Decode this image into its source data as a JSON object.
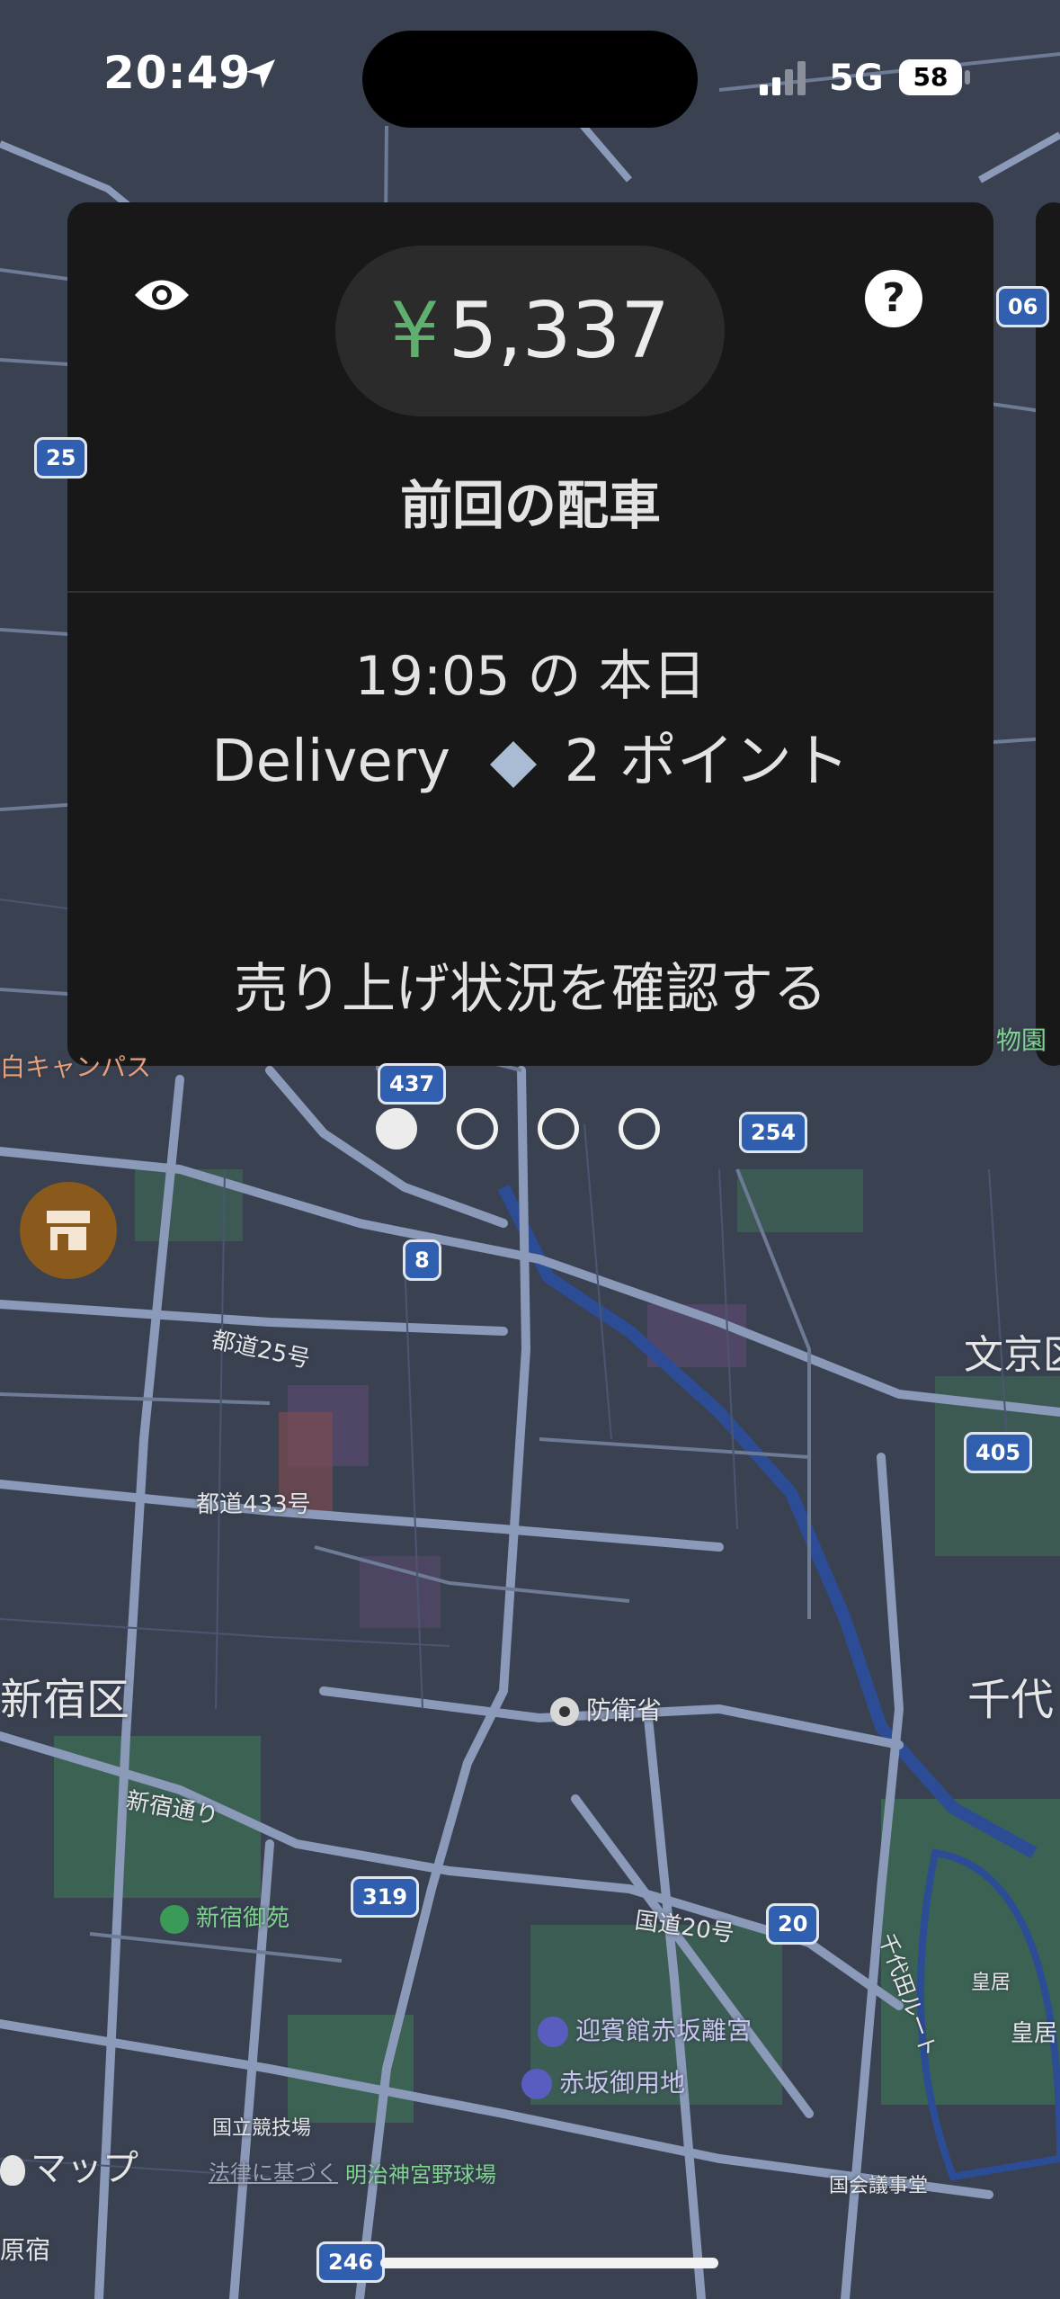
{
  "status_bar": {
    "time": "20:49",
    "network": "5G",
    "battery": "58"
  },
  "earnings_card": {
    "currency": "¥",
    "amount": "5,337",
    "title": "前回の配車",
    "trip_time": "19:05 の 本日",
    "trip_type": "Delivery",
    "points": "2 ポイント",
    "link_label": "売り上げ状況を確認する"
  },
  "pager": {
    "count": 4,
    "active_index": 0
  },
  "map": {
    "labels": {
      "bunkyo": "文京区",
      "shinjuku_ku": "新宿区",
      "chiyoda": "千代",
      "road_25": "都道25号",
      "road_433": "都道433号",
      "shinjuku_dori": "新宿通り",
      "kokudo_20": "国道20号",
      "boeisho": "防衛省",
      "shinjuku_gyoen": "新宿御苑",
      "geihinkan": "迎賓館赤坂離宮",
      "akasaka_goyochi": "赤坂御用地",
      "kokuritsu": "国立競技場",
      "jingu": "明治神宮野球場",
      "kokkai": "国会議事堂",
      "kokyo": "皇居",
      "kokyo2": "皇居",
      "harajuku": "原宿",
      "campus": "白キャンパス",
      "museum": "物園",
      "legal": "法律に基づく",
      "brand": "マップ",
      "chiyoda_route": "千代田ルート"
    },
    "shields": {
      "s437": "437",
      "s254": "254",
      "s8": "8",
      "s405": "405",
      "s319": "319",
      "s20": "20",
      "s246": "246",
      "s25": "25",
      "s06": "06"
    }
  }
}
